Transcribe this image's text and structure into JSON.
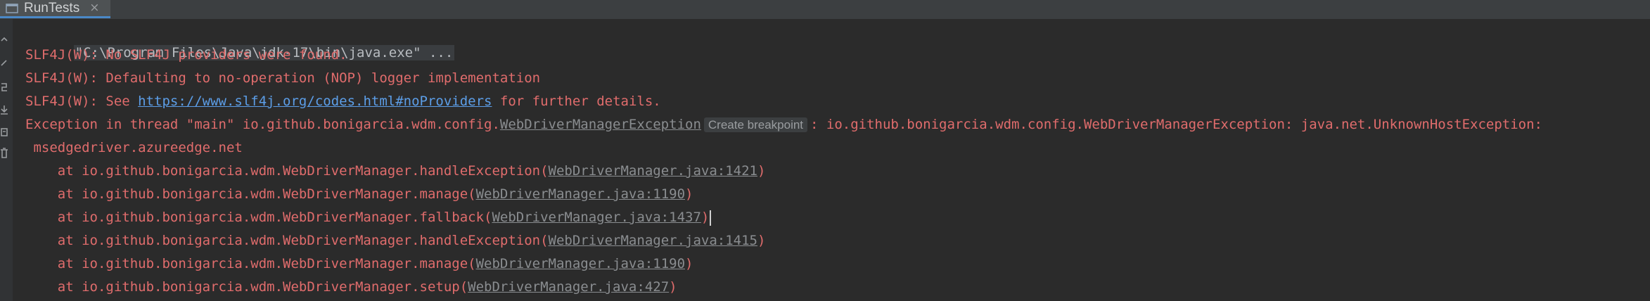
{
  "tab": {
    "icon": "console-icon",
    "label": "RunTests",
    "close": "×"
  },
  "toolbar": {
    "icons": [
      "arrow-up-icon",
      "wrap-icon",
      "rerun-icon",
      "download-icon",
      "print-icon",
      "trash-icon"
    ]
  },
  "console": {
    "cmd": "\"C:\\Program Files\\Java\\jdk-17\\bin\\java.exe\" ...",
    "slf_no_providers": "SLF4J(W): No SLF4J providers were found.",
    "slf_nop": "SLF4J(W): Defaulting to no-operation (NOP) logger implementation",
    "slf_see_prefix": "SLF4J(W): See ",
    "slf_link": "https://www.slf4j.org/codes.html#noProviders",
    "slf_see_suffix": " for further details.",
    "exception": {
      "prefix": "Exception in thread \"main\" io.github.bonigarcia.wdm.config.",
      "class_link": "WebDriverManagerException",
      "breakpoint": "Create breakpoint",
      "suffix": ": io.github.bonigarcia.wdm.config.WebDriverManagerException: java.net.UnknownHostException:",
      "continuation": " msedgedriver.azureedge.net"
    },
    "stack": [
      {
        "prefix": "    at io.github.bonigarcia.wdm.WebDriverManager.handleException(",
        "link": "WebDriverManager.java:1421",
        "suffix": ")"
      },
      {
        "prefix": "    at io.github.bonigarcia.wdm.WebDriverManager.manage(",
        "link": "WebDriverManager.java:1190",
        "suffix": ")"
      },
      {
        "prefix": "    at io.github.bonigarcia.wdm.WebDriverManager.fallback(",
        "link": "WebDriverManager.java:1437",
        "suffix": ")"
      },
      {
        "prefix": "    at io.github.bonigarcia.wdm.WebDriverManager.handleException(",
        "link": "WebDriverManager.java:1415",
        "suffix": ")"
      },
      {
        "prefix": "    at io.github.bonigarcia.wdm.WebDriverManager.manage(",
        "link": "WebDriverManager.java:1190",
        "suffix": ")"
      },
      {
        "prefix": "    at io.github.bonigarcia.wdm.WebDriverManager.setup(",
        "link": "WebDriverManager.java:427",
        "suffix": ")"
      }
    ]
  },
  "colors": {
    "error_text": "#e06c6c",
    "link_blue": "#5c9ee8",
    "link_gray": "#8a8d90",
    "tab_accent": "#4a88c7"
  }
}
